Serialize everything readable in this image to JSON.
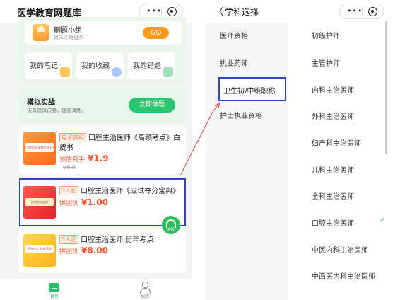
{
  "left": {
    "app_title": "医学教育网题库",
    "study_group": {
      "title": "刷题小组",
      "subtitle": "尚未开始组队~",
      "button": "GO"
    },
    "quick_links": [
      "我的笔记",
      "我的收藏",
      "我的错题"
    ],
    "mock_exam": {
      "title": "模拟实战",
      "subtitle": "仿真模拟试卷，提前演练。",
      "button": "立即做题"
    },
    "products": [
      {
        "tag": "电子资料",
        "name": "口腔主治医师《高频考点》白皮书",
        "price_label": "预估到手",
        "price": "¥1.9",
        "old_price": "¥6.9"
      },
      {
        "tag": "3人团",
        "name": "口腔主治医师《应试夺分宝典》",
        "price_label": "拼团价",
        "price": "¥1.00"
      },
      {
        "tag": "3人团",
        "name": "口腔主治医师·历年考点",
        "price_label": "拼团价",
        "price": "¥8.00"
      }
    ],
    "thumbs": [
      "口腔医师 高频考点 白皮书",
      "应试夺分宝典",
      "历年考点 思维导图"
    ],
    "headset_label": "客服",
    "tabs": {
      "home": "首页",
      "me": "我的"
    }
  },
  "right": {
    "back_glyph": "〈",
    "title": "学科选择",
    "categories": [
      "医师资格",
      "执业药师",
      "卫生初/中级职称",
      "护士执业资格"
    ],
    "active_category_index": 2,
    "subjects": [
      "初级护师",
      "主管护师",
      "内科主治医师",
      "外科主治医师",
      "妇产科主治医师",
      "儿科主治医师",
      "全科主治医师",
      "口腔主治医师",
      "中医内科主治医师",
      "中西医内科主治医师"
    ],
    "selected_subject_index": 7,
    "check_glyph": "✓"
  },
  "colors": {
    "brand_green": "#2bbf5b",
    "price_red": "#ff4d2e",
    "annotation_blue": "#2b46c9",
    "annotation_red": "#e0463c"
  }
}
